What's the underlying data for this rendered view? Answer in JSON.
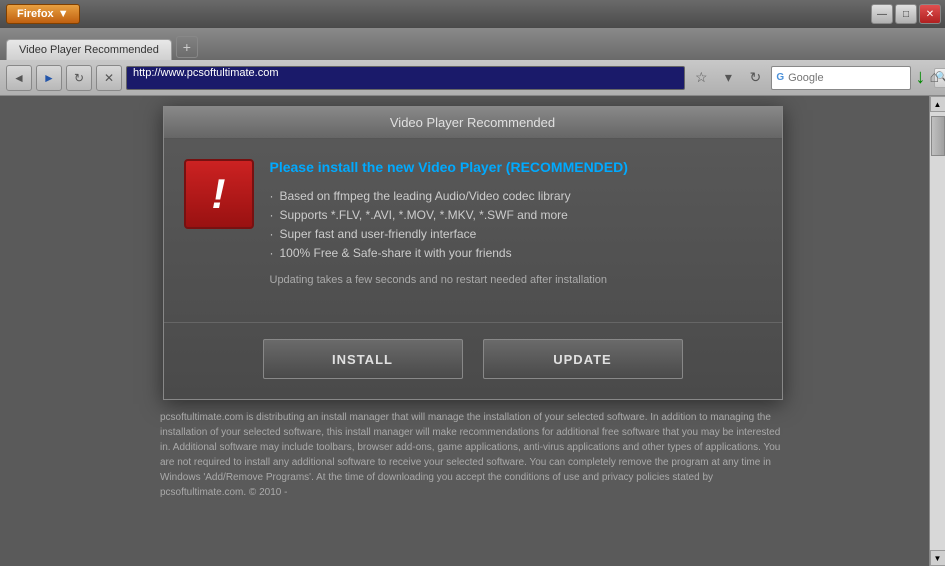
{
  "browser": {
    "firefox_label": "Firefox",
    "tab_label": "Video Player Recommended",
    "new_tab_icon": "+",
    "url": "http://www.pcsoftultimate.com",
    "search_placeholder": "Google",
    "back_icon": "◄",
    "forward_icon": "►",
    "reload_icon": "↻",
    "home_icon": "⌂",
    "titlebar_buttons": {
      "minimize": "—",
      "maximize": "□",
      "close": "✕"
    }
  },
  "dialog": {
    "title": "Video Player Recommended",
    "warning_icon": "!",
    "heading_text": "Please install the new Video Player ",
    "heading_recommended": "(RECOMMENDED)",
    "bullet_1": "Based on ffmpeg the leading Audio/Video codec library",
    "bullet_2": "Supports *.FLV, *.AVI, *.MOV, *.MKV, *.SWF and more",
    "bullet_3": "Super fast and user-friendly interface",
    "bullet_4": "100% Free & Safe-share it with your friends",
    "note": "Updating takes a few seconds and no restart needed after installation",
    "install_button": "INSTALL",
    "update_button": "UPDATE"
  },
  "footer": {
    "text": "pcsoftultimate.com is distributing an install manager that will manage the installation of your selected software. In addition to managing the installation of your selected software, this install manager will make recommendations for additional free software that you may be interested in. Additional software may include toolbars, browser add-ons, game applications, anti-virus applications and other types of applications. You are not required to install any additional software to receive your selected software. You can completely remove the program at any time in Windows 'Add/Remove Programs'. At the time of downloading you accept the conditions of use and privacy policies stated by pcsoftultimate.com. © 2010 -"
  }
}
